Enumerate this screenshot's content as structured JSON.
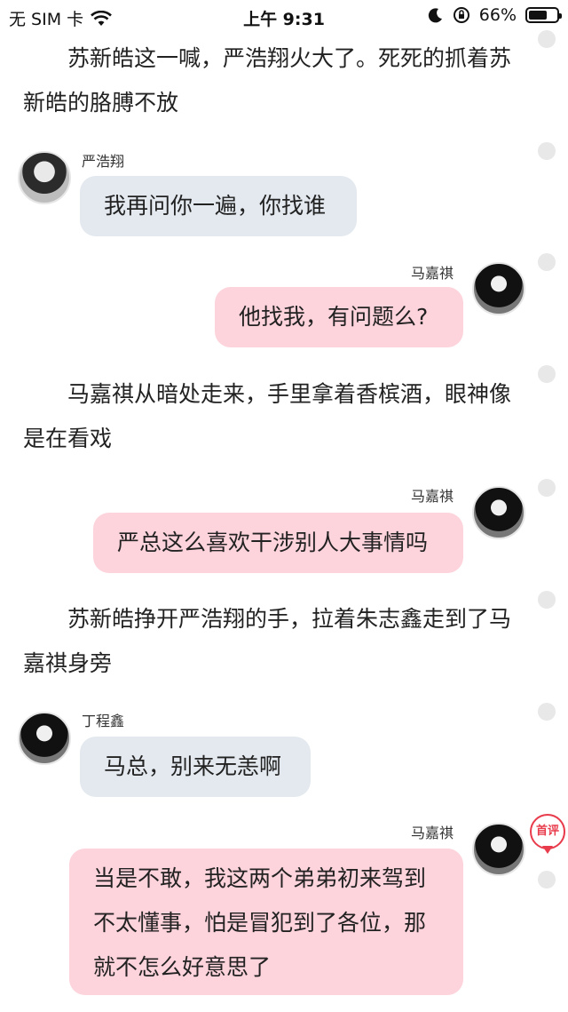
{
  "status_bar": {
    "carrier": "无 SIM 卡",
    "time": "上午 9:31",
    "battery_text": "66%",
    "battery_level": 0.66
  },
  "story": [
    {
      "type": "narration",
      "text": "苏新皓这一喊，严浩翔火大了。死死的抓着苏新皓的胳膊不放"
    },
    {
      "type": "message",
      "side": "left",
      "name": "严浩翔",
      "text": "我再问你一遍，你找谁"
    },
    {
      "type": "message",
      "side": "right",
      "name": "马嘉祺",
      "text": "他找我，有问题么?"
    },
    {
      "type": "narration",
      "text": "马嘉祺从暗处走来，手里拿着香槟酒，眼神像是在看戏"
    },
    {
      "type": "message",
      "side": "right",
      "name": "马嘉祺",
      "text": "严总这么喜欢干涉别人大事情吗"
    },
    {
      "type": "narration",
      "text": "苏新皓挣开严浩翔的手，拉着朱志鑫走到了马嘉祺身旁"
    },
    {
      "type": "message",
      "side": "left",
      "name": "丁程鑫",
      "text": "马总，别来无恙啊"
    },
    {
      "type": "message",
      "side": "right",
      "name": "马嘉祺",
      "text": "当是不敢，我这两个弟弟初来驾到不太懂事，怕是冒犯到了各位，那就不怎么好意思了"
    }
  ],
  "comment_badge": "首评"
}
